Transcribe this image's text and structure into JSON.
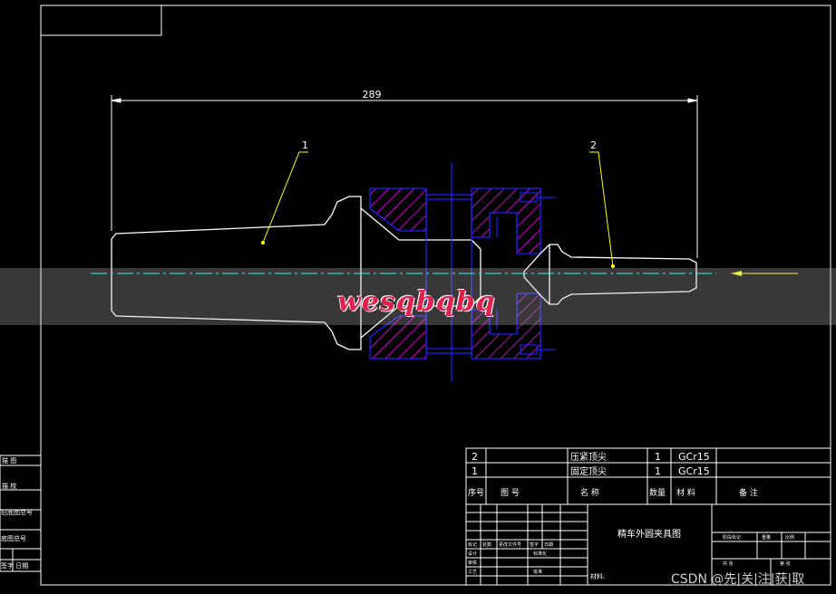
{
  "dimension": {
    "overall_length": "289"
  },
  "balloons": {
    "part1": "1",
    "part2": "2"
  },
  "bom": {
    "rows": [
      {
        "no": "2",
        "name": "压紧顶尖",
        "qty": "1",
        "material": "GCr15"
      },
      {
        "no": "1",
        "name": "固定顶尖",
        "qty": "1",
        "material": "GCr15"
      }
    ],
    "header": {
      "no": "序号",
      "drawing_no": "图 号",
      "name": "名 称",
      "qty": "数量",
      "material": "材 料",
      "remarks": "备 注"
    }
  },
  "title_block": {
    "drawing_title": "精车外圆夹具图",
    "left_labels": [
      "标记",
      "处数",
      "更改文件号",
      "签字",
      "日期"
    ],
    "designer": "设计",
    "standardize": "标准化",
    "check": "审核",
    "process": "工艺",
    "approve": "批准",
    "material_label": "材料:",
    "right_labels": [
      "阶段标记",
      "重量",
      "比例"
    ],
    "sheet_labels": [
      "共 张",
      "第 张"
    ]
  },
  "side_table": [
    "描 图",
    "描 校",
    "旧底图总号",
    "底图总号",
    "签字  日期"
  ],
  "watermark": "wesqbqbq",
  "source_credit": "CSDN @先|关|注|获|取",
  "colors": {
    "line": "#ffffff",
    "dimension": "#ffffff",
    "leader": "#ffff00",
    "hatch": "#ff00ff",
    "outline_blue": "#2020ff",
    "centerline": "#00ffff"
  }
}
